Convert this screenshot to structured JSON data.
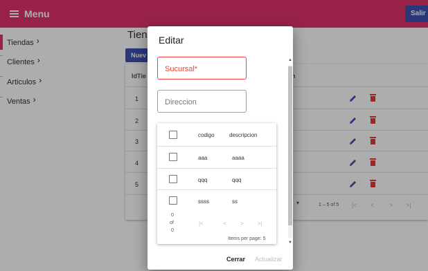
{
  "appbar": {
    "menu_label": "Menu",
    "salir_label": "Salir"
  },
  "sidebar": {
    "items": [
      {
        "label": "Tiendas"
      },
      {
        "label": "Clientes"
      },
      {
        "label": "Articulos"
      },
      {
        "label": "Ventas"
      }
    ]
  },
  "main": {
    "title": "Tien",
    "nuevo_label": "Nuev",
    "header_id": "IdTie",
    "header_right": "n",
    "rows": [
      {
        "id": "1"
      },
      {
        "id": "2"
      },
      {
        "id": "3"
      },
      {
        "id": "4"
      },
      {
        "id": "5"
      }
    ],
    "pager_range": "1 – 5 of 5"
  },
  "dialog": {
    "title": "Editar",
    "sucursal_placeholder": "Sucursal*",
    "direccion_placeholder": "Direccion",
    "table": {
      "headers": [
        "codigo",
        "descripcion"
      ],
      "rows": [
        {
          "codigo": "aaa",
          "descripcion": "aaaa"
        },
        {
          "codigo": "qqq",
          "descripcion": "qqq"
        },
        {
          "codigo": "ssss",
          "descripcion": "ss"
        }
      ],
      "pager_count": [
        "0",
        "of",
        "0"
      ],
      "items_per_page": "Items per page: 5"
    },
    "cerrar_label": "Cerrar",
    "actualizar_label": "Actualizar"
  },
  "colors": {
    "appbar": "#e0336a",
    "primary": "#3f51b5",
    "error": "#f44336",
    "delete": "#e53935"
  }
}
